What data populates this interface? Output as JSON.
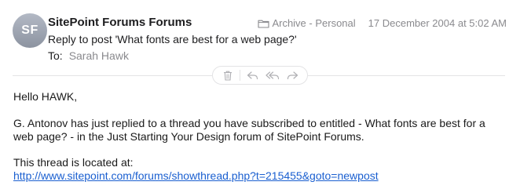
{
  "message": {
    "avatar_initials": "SF",
    "sender": "SitePoint Forums Forums",
    "subject": "Reply to post 'What fonts are best for a web page?'",
    "to_label": "To:",
    "to_name": "Sarah Hawk",
    "mailbox": "Archive - Personal",
    "date": "17 December 2004 at 5:02 AM"
  },
  "toolbar": {
    "icons": [
      "trash-icon",
      "reply-icon",
      "reply-all-icon",
      "forward-icon"
    ]
  },
  "body": {
    "greeting": "Hello HAWK,",
    "paragraph": "G. Antonov has just replied to a thread you have subscribed to entitled - What fonts are best for a web page? - in the Just Starting Your Design forum of SitePoint Forums.",
    "location_label": "This thread is located at:",
    "link": "http://www.sitepoint.com/forums/showthread.php?t=215455&goto=newpost"
  },
  "colors": {
    "accent_link": "#1a5fd0",
    "muted_text": "#8a8a8e",
    "avatar_bg": "#9aa0ab"
  }
}
